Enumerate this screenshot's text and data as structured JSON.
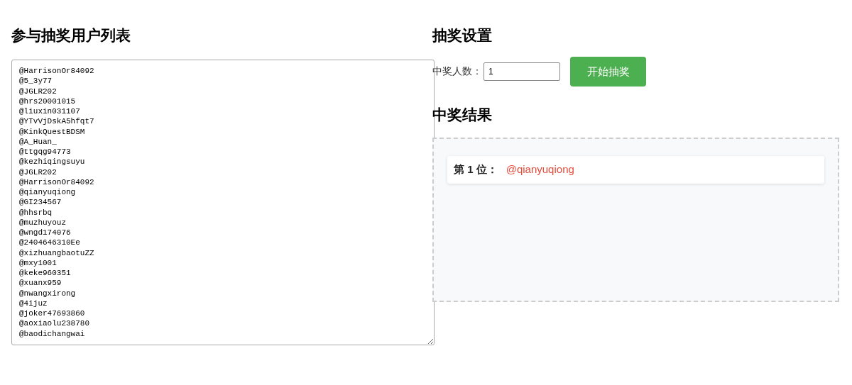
{
  "participants": {
    "title": "参与抽奖用户列表",
    "users": [
      "@HarrisonOr84092",
      "@5_3y77",
      "@JGLR202",
      "@hrs20001015",
      "@liuxin031107",
      "@YTvVjDskA5hfqt7",
      "@KinkQuestBDSM",
      "@A_Huan_",
      "@ttgqg94773",
      "@kezhiqingsuyu",
      "@JGLR202",
      "@HarrisonOr84092",
      "@qianyuqiong",
      "@GI234567",
      "@hhsrbq",
      "@muzhuyouz",
      "@wngd174076",
      "@2404646310Ee",
      "@xizhuangbaotuZZ",
      "@mxy1001",
      "@keke960351",
      "@xuanx959",
      "@nwangxirong",
      "@4ijuz",
      "@joker47693860",
      "@aoxiaolu238780",
      "@baodichangwai"
    ]
  },
  "settings": {
    "title": "抽奖设置",
    "count_label": "中奖人数：",
    "count_value": "1",
    "start_button": "开始抽奖"
  },
  "results": {
    "title": "中奖结果",
    "winners": [
      {
        "rank": "第 1 位：",
        "name": "@qianyuqiong"
      }
    ]
  }
}
